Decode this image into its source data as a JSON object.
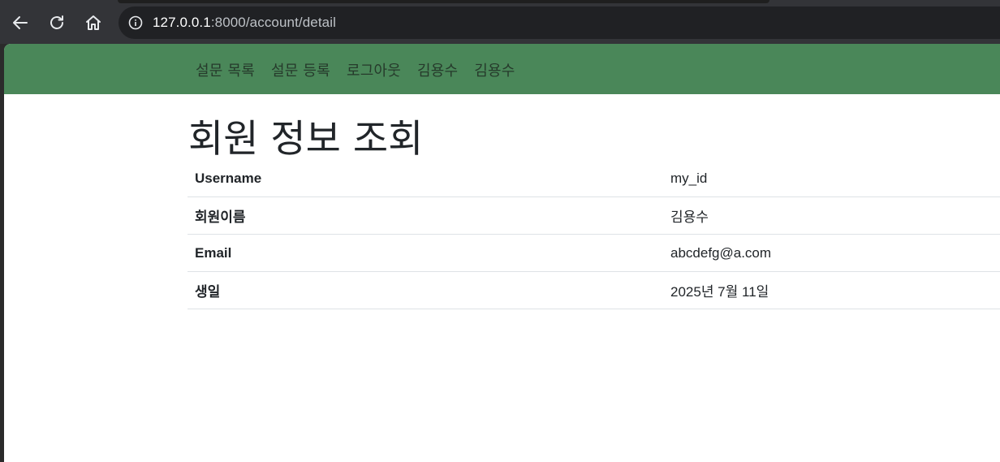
{
  "browser": {
    "url_host": "127.0.0.1",
    "url_rest": ":8000/account/detail",
    "icons": {
      "back": "back-arrow-icon",
      "reload": "reload-icon",
      "home": "home-icon",
      "info": "info-icon"
    }
  },
  "nav": {
    "links": [
      "설문 목록",
      "설문 등록",
      "로그아웃",
      "김용수",
      "김용수"
    ]
  },
  "page": {
    "title": "회원 정보 조회"
  },
  "details": [
    {
      "label": "Username",
      "value": "my_id"
    },
    {
      "label": "회원이름",
      "value": "김용수"
    },
    {
      "label": "Email",
      "value": "abcdefg@a.com"
    },
    {
      "label": "생일",
      "value": "2025년 7월 11일"
    }
  ],
  "colors": {
    "navbar": "#4a8759",
    "nav_text": "#263a2b",
    "chrome": "#333438",
    "omnibox": "#202124"
  }
}
